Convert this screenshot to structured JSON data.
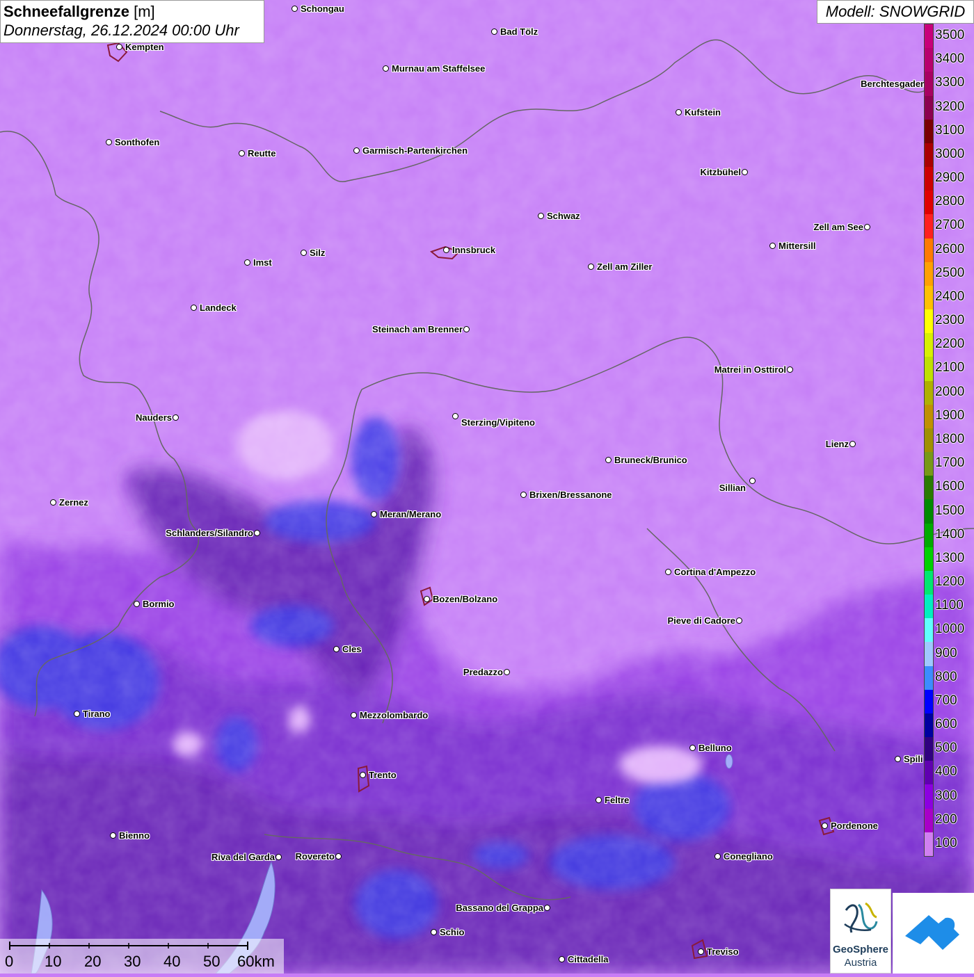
{
  "header": {
    "title_bold": "Schneefallgrenze",
    "title_unit": "[m]",
    "date": "Donnerstag, 26.12.2024 00:00 Uhr",
    "model": "Modell: SNOWGRID"
  },
  "legend": {
    "labels": [
      "3500",
      "3400",
      "3300",
      "3200",
      "3100",
      "3000",
      "2900",
      "2800",
      "2700",
      "2600",
      "2500",
      "2400",
      "2300",
      "2200",
      "2100",
      "2000",
      "1900",
      "1800",
      "1700",
      "1600",
      "1500",
      "1400",
      "1300",
      "1200",
      "1100",
      "1000",
      "900",
      "800",
      "700",
      "600",
      "500",
      "400",
      "300",
      "200",
      "100"
    ],
    "colors": [
      "#c8007a",
      "#b8006e",
      "#a80062",
      "#8c0050",
      "#7a0000",
      "#aa0000",
      "#cc0000",
      "#e00000",
      "#ff2020",
      "#ff7a00",
      "#ffa000",
      "#ffc000",
      "#ffff00",
      "#d8f000",
      "#c0e000",
      "#b0b000",
      "#c09000",
      "#a09000",
      "#789818",
      "#2a7a00",
      "#008a00",
      "#00aa00",
      "#00d000",
      "#00e870",
      "#00f0c0",
      "#60ffff",
      "#a0c8ff",
      "#3c8cff",
      "#0000ff",
      "#0000a0",
      "#300080",
      "#6000b0",
      "#8c00e0",
      "#a800c8",
      "#d080f0"
    ]
  },
  "scale": {
    "labels": [
      "0",
      "10",
      "20",
      "30",
      "40",
      "50",
      "60km"
    ]
  },
  "logos": {
    "geosphere_line1": "GeoSphere",
    "geosphere_line2": "Austria"
  },
  "cities": [
    {
      "name": "Schongau"
    },
    {
      "name": "Bad Tölz"
    },
    {
      "name": "Kempten"
    },
    {
      "name": "Murnau am Staffelsee"
    },
    {
      "name": "Berchtesgaden"
    },
    {
      "name": "Kufstein"
    },
    {
      "name": "Sonthofen"
    },
    {
      "name": "Reutte"
    },
    {
      "name": "Garmisch-Partenkirchen"
    },
    {
      "name": "Kitzbühel"
    },
    {
      "name": "Schwaz"
    },
    {
      "name": "Zell am See"
    },
    {
      "name": "Innsbruck"
    },
    {
      "name": "Mittersill"
    },
    {
      "name": "Imst"
    },
    {
      "name": "Silz"
    },
    {
      "name": "Zell am Ziller"
    },
    {
      "name": "Landeck"
    },
    {
      "name": "Steinach am Brenner"
    },
    {
      "name": "Matrei in Osttirol"
    },
    {
      "name": "Nauders"
    },
    {
      "name": "Sterzing/Vipiteno"
    },
    {
      "name": "Lienz"
    },
    {
      "name": "Bruneck/Brunico"
    },
    {
      "name": "Sillian"
    },
    {
      "name": "Zernez"
    },
    {
      "name": "Brixen/Bressanone"
    },
    {
      "name": "Meran/Merano"
    },
    {
      "name": "Schlanders/Silandro"
    },
    {
      "name": "Cortina d'Ampezzo"
    },
    {
      "name": "Bozen/Bolzano"
    },
    {
      "name": "Bormio"
    },
    {
      "name": "Pieve di Cadore"
    },
    {
      "name": "Cles"
    },
    {
      "name": "Predazzo"
    },
    {
      "name": "Tirano"
    },
    {
      "name": "Mezzolombardo"
    },
    {
      "name": "Belluno"
    },
    {
      "name": "Spili"
    },
    {
      "name": "Trento"
    },
    {
      "name": "Feltre"
    },
    {
      "name": "Pordenone"
    },
    {
      "name": "Bienno"
    },
    {
      "name": "Riva del Garda"
    },
    {
      "name": "Rovereto"
    },
    {
      "name": "Conegliano"
    },
    {
      "name": "Bassano del Grappa"
    },
    {
      "name": "Schio"
    },
    {
      "name": "Treviso"
    },
    {
      "name": "Cittadella"
    }
  ]
}
